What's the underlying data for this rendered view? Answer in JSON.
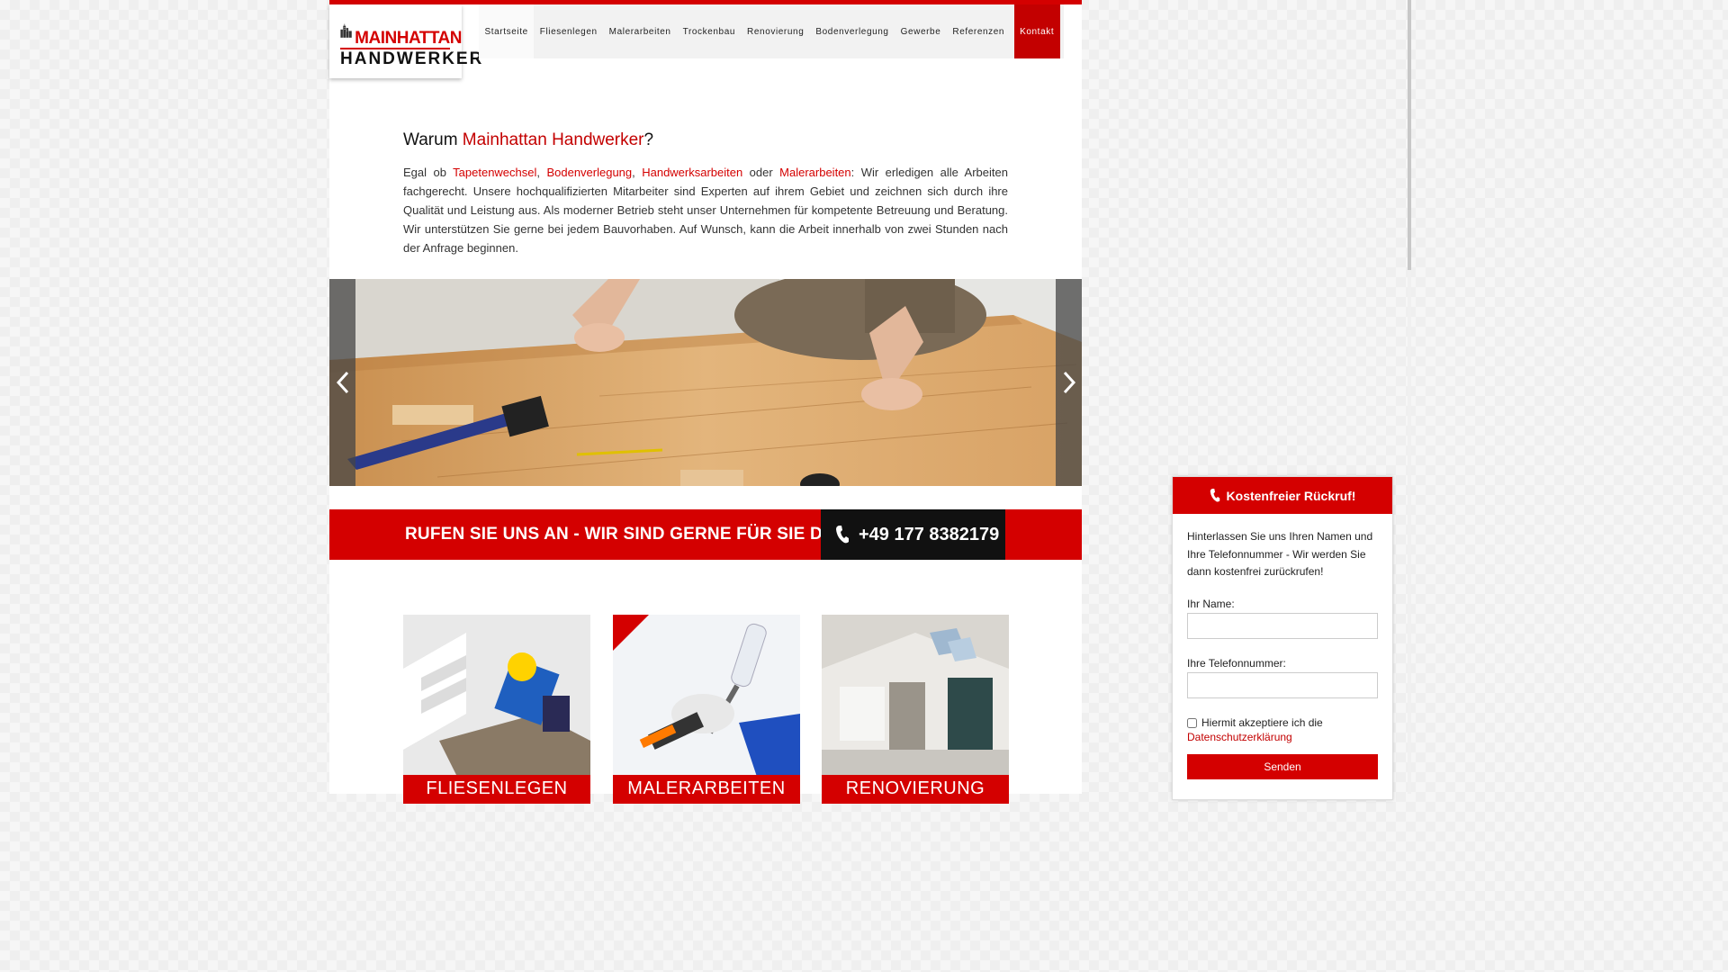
{
  "logo": {
    "line1": "MAINHATTAN",
    "line2": "HANDWERKER"
  },
  "nav": {
    "items": [
      {
        "label": "Startseite"
      },
      {
        "label": "Fliesenlegen"
      },
      {
        "label": "Malerarbeiten"
      },
      {
        "label": "Trockenbau"
      },
      {
        "label": "Renovierung"
      },
      {
        "label": "Bodenverlegung"
      },
      {
        "label": "Gewerbe"
      },
      {
        "label": "Referenzen"
      }
    ],
    "contact": "Kontakt"
  },
  "intro": {
    "title_prefix": "Warum ",
    "title_brand": "Mainhattan Handwerker",
    "title_suffix": "?",
    "p_start": "Egal ob ",
    "link1": "Tapetenwechsel",
    "sep1": ", ",
    "link2": "Bodenverlegung",
    "sep2": ", ",
    "link3": "Handwerksarbeiten",
    "sep3": " oder ",
    "link4": "Malerarbeiten",
    "p_rest": ": Wir erledigen alle Arbeiten fachgerecht. Unsere hochqualifizierten Mitarbeiter sind Experten auf ihrem Gebiet und zeichnen sich durch ihre Qualität und Leistung aus. Als moderner Betrieb steht unser Unternehmen für kompetente Betreuung und Beratung. Wir unterstützen Sie gerne bei jedem Bauvorhaben. Auf Wunsch, kann die Arbeit innerhalb von zwei Stunden nach der Anfrage beginnen."
  },
  "callbar": {
    "text": "RUFEN SIE UNS AN - WIR SIND GERNE FÜR SIE DA!",
    "phone": "+49 177 8382179"
  },
  "cards": [
    {
      "label": "FLIESENLEGEN"
    },
    {
      "label": "MALERARBEITEN"
    },
    {
      "label": "RENOVIERUNG"
    }
  ],
  "callback": {
    "title": "Kostenfreier Rückruf!",
    "description": "Hinterlassen Sie uns Ihren Namen und Ihre Telefonnummer - Wir werden Sie dann kostenfrei zurückrufen!",
    "name_label": "Ihr Name:",
    "phone_label": "Ihre Telefonnummer:",
    "consent_text": "Hiermit akzeptiere ich die",
    "privacy_link": "Datenschutzerklärung",
    "send_label": "Senden"
  },
  "colors": {
    "accent": "#d40000",
    "dark": "#111111"
  },
  "icons": [
    "logo-buildings-icon",
    "chevron-left-icon",
    "chevron-right-icon",
    "phone-icon"
  ]
}
